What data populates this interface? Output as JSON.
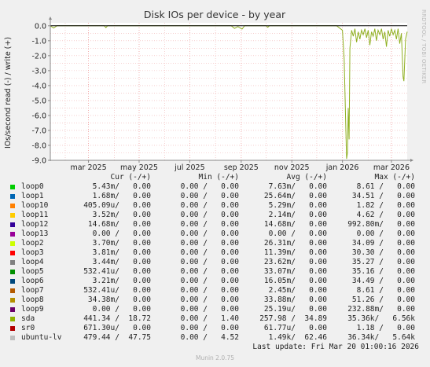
{
  "chart_data": {
    "type": "line",
    "title": "Disk IOs per device - by year",
    "ylabel": "IOs/second read (-) / write (+)",
    "watermark": "RRDTOOL / TOBI OETIKER",
    "ylim": [
      -9.0,
      0.2
    ],
    "yticks": [
      0.0,
      -1.0,
      -2.0,
      -3.0,
      -4.0,
      -5.0,
      -6.0,
      -7.0,
      -8.0,
      -9.0
    ],
    "ytick_labels": [
      "0.0",
      "-1.0",
      "-2.0",
      "-3.0",
      "-4.0",
      "-5.0",
      "-6.0",
      "-7.0",
      "-8.0",
      "-9.0"
    ],
    "xlim": [
      "2025-01-14",
      "2026-03-20"
    ],
    "xticks": [
      "2025-03-01",
      "2025-05-01",
      "2025-07-01",
      "2025-09-01",
      "2025-11-01",
      "2026-01-01",
      "2026-03-01"
    ],
    "xtick_labels": [
      "mar 2025",
      "may 2025",
      "jul 2025",
      "sep 2025",
      "nov 2025",
      "jan 2026",
      "mar 2026"
    ],
    "grid": true,
    "series": [
      {
        "name": "sda",
        "color": "#8fb021",
        "points": [
          [
            "2025-01-14",
            0.0
          ],
          [
            "2025-01-18",
            -0.15
          ],
          [
            "2025-01-22",
            0.0
          ],
          [
            "2025-02-01",
            0.0
          ],
          [
            "2025-03-20",
            0.0
          ],
          [
            "2025-03-22",
            -0.12
          ],
          [
            "2025-03-24",
            0.0
          ],
          [
            "2025-08-20",
            0.0
          ],
          [
            "2025-08-24",
            -0.18
          ],
          [
            "2025-08-28",
            -0.05
          ],
          [
            "2025-09-02",
            -0.22
          ],
          [
            "2025-09-05",
            0.0
          ],
          [
            "2025-10-01",
            0.0
          ],
          [
            "2025-10-03",
            -0.1
          ],
          [
            "2025-10-05",
            0.0
          ],
          [
            "2025-12-25",
            0.0
          ],
          [
            "2026-01-01",
            -0.3
          ],
          [
            "2026-01-03",
            -2.2
          ],
          [
            "2026-01-05",
            -6.8
          ],
          [
            "2026-01-06",
            -8.9
          ],
          [
            "2026-01-07",
            -8.5
          ],
          [
            "2026-01-08",
            -5.5
          ],
          [
            "2026-01-09",
            -7.6
          ],
          [
            "2026-01-10",
            -1.5
          ],
          [
            "2026-01-12",
            -0.3
          ],
          [
            "2026-01-14",
            -0.7
          ],
          [
            "2026-01-16",
            -0.2
          ],
          [
            "2026-01-18",
            -1.1
          ],
          [
            "2026-01-20",
            -0.4
          ],
          [
            "2026-01-22",
            -0.9
          ],
          [
            "2026-01-24",
            -0.3
          ],
          [
            "2026-01-26",
            -0.6
          ],
          [
            "2026-01-28",
            -0.2
          ],
          [
            "2026-01-30",
            -0.8
          ],
          [
            "2026-02-01",
            -0.3
          ],
          [
            "2026-02-03",
            -1.3
          ],
          [
            "2026-02-05",
            -0.4
          ],
          [
            "2026-02-07",
            -0.7
          ],
          [
            "2026-02-09",
            -0.2
          ],
          [
            "2026-02-11",
            -1.0
          ],
          [
            "2026-02-13",
            -0.3
          ],
          [
            "2026-02-15",
            -0.6
          ],
          [
            "2026-02-17",
            -0.2
          ],
          [
            "2026-02-19",
            -0.9
          ],
          [
            "2026-02-21",
            -0.4
          ],
          [
            "2026-02-23",
            -1.4
          ],
          [
            "2026-02-25",
            -0.3
          ],
          [
            "2026-02-27",
            -0.7
          ],
          [
            "2026-03-01",
            -0.2
          ],
          [
            "2026-03-03",
            -0.6
          ],
          [
            "2026-03-05",
            -0.3
          ],
          [
            "2026-03-07",
            -0.9
          ],
          [
            "2026-03-09",
            -0.2
          ],
          [
            "2026-03-11",
            -1.2
          ],
          [
            "2026-03-13",
            -0.5
          ],
          [
            "2026-03-15",
            -3.4
          ],
          [
            "2026-03-16",
            -3.7
          ],
          [
            "2026-03-17",
            -2.4
          ],
          [
            "2026-03-18",
            -0.9
          ],
          [
            "2026-03-20",
            -0.4
          ]
        ]
      }
    ]
  },
  "legend": {
    "headers": {
      "cur": "Cur (-/+)",
      "min": "Min (-/+)",
      "avg": "Avg (-/+)",
      "max": "Max (-/+)"
    },
    "rows": [
      {
        "name": "loop0",
        "color": "#00cc00",
        "cur": "5.43m/   0.00",
        "min": "0.00 /   0.00",
        "avg": "7.63m/   0.00",
        "max": "8.61 /   0.00"
      },
      {
        "name": "loop1",
        "color": "#0066b3",
        "cur": "1.68m/   0.00",
        "min": "0.00 /   0.00",
        "avg": "25.64m/   0.00",
        "max": "34.51 /   0.00"
      },
      {
        "name": "loop10",
        "color": "#ff8000",
        "cur": "405.09u/   0.00",
        "min": "0.00 /   0.00",
        "avg": "5.29m/   0.00",
        "max": "1.82 /   0.00"
      },
      {
        "name": "loop11",
        "color": "#ffcc00",
        "cur": "3.52m/   0.00",
        "min": "0.00 /   0.00",
        "avg": "2.14m/   0.00",
        "max": "4.62 /   0.00"
      },
      {
        "name": "loop12",
        "color": "#330099",
        "cur": "14.68m/   0.00",
        "min": "0.00 /   0.00",
        "avg": "14.68m/   0.00",
        "max": "992.80m/   0.00"
      },
      {
        "name": "loop13",
        "color": "#990099",
        "cur": "0.00 /   0.00",
        "min": "0.00 /   0.00",
        "avg": "0.00 /   0.00",
        "max": "0.00 /   0.00"
      },
      {
        "name": "loop2",
        "color": "#ccff00",
        "cur": "3.70m/   0.00",
        "min": "0.00 /   0.00",
        "avg": "26.31m/   0.00",
        "max": "34.09 /   0.00"
      },
      {
        "name": "loop3",
        "color": "#ff0000",
        "cur": "3.81m/   0.00",
        "min": "0.00 /   0.00",
        "avg": "11.39m/   0.00",
        "max": "30.30 /   0.00"
      },
      {
        "name": "loop4",
        "color": "#808080",
        "cur": "3.44m/   0.00",
        "min": "0.00 /   0.00",
        "avg": "23.62m/   0.00",
        "max": "35.27 /   0.00"
      },
      {
        "name": "loop5",
        "color": "#008f00",
        "cur": "532.41u/   0.00",
        "min": "0.00 /   0.00",
        "avg": "33.07m/   0.00",
        "max": "35.16 /   0.00"
      },
      {
        "name": "loop6",
        "color": "#00487d",
        "cur": "3.21m/   0.00",
        "min": "0.00 /   0.00",
        "avg": "16.05m/   0.00",
        "max": "34.49 /   0.00"
      },
      {
        "name": "loop7",
        "color": "#b35a00",
        "cur": "532.41u/   0.00",
        "min": "0.00 /   0.00",
        "avg": "2.45m/   0.00",
        "max": "8.61 /   0.00"
      },
      {
        "name": "loop8",
        "color": "#b38f00",
        "cur": "34.38m/   0.00",
        "min": "0.00 /   0.00",
        "avg": "33.88m/   0.00",
        "max": "51.26 /   0.00"
      },
      {
        "name": "loop9",
        "color": "#6b006b",
        "cur": "0.00 /   0.00",
        "min": "0.00 /   0.00",
        "avg": "25.19u/   0.00",
        "max": "232.88m/   0.00"
      },
      {
        "name": "sda",
        "color": "#8fb300",
        "cur": "441.34 /  18.72",
        "min": "0.00 /   1.40",
        "avg": "257.98 /  34.89",
        "max": "35.36k/   6.56k"
      },
      {
        "name": "sr0",
        "color": "#b30000",
        "cur": "671.30u/   0.00",
        "min": "0.00 /   0.00",
        "avg": "61.77u/   0.00",
        "max": "1.18 /   0.00"
      },
      {
        "name": "ubuntu-lv",
        "color": "#bebebe",
        "cur": "479.44 /  47.75",
        "min": "0.00 /   4.52",
        "avg": "1.49k/  62.46",
        "max": "36.34k/   5.64k"
      }
    ]
  },
  "last_update": "Last update: Fri Mar 20 01:00:16 2026",
  "munin_version": "Munin 2.0.75"
}
